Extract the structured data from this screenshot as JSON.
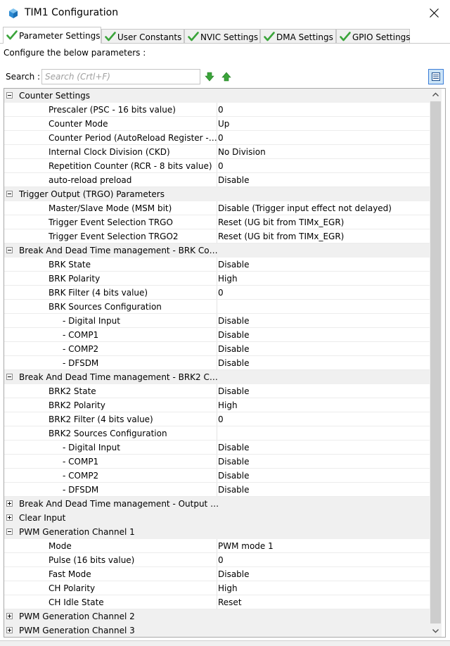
{
  "window": {
    "title": "TIM1 Configuration",
    "app_icon": "cube-icon",
    "close_icon": "close-icon"
  },
  "tabs": [
    {
      "label": "Parameter Settings",
      "icon": "checkmark-icon",
      "active": true
    },
    {
      "label": "User Constants",
      "icon": "checkmark-icon",
      "active": false
    },
    {
      "label": "NVIC Settings",
      "icon": "checkmark-icon",
      "active": false
    },
    {
      "label": "DMA Settings",
      "icon": "checkmark-icon",
      "active": false
    },
    {
      "label": "GPIO Settings",
      "icon": "checkmark-icon",
      "active": false
    }
  ],
  "configure_label": "Configure the below parameters :",
  "search": {
    "label": "Search :",
    "placeholder": "Search (Crtl+F)",
    "value": ""
  },
  "colors": {
    "checkmark": "#3aa43a",
    "arrow": "#3aa43a",
    "group_bg": "#f0f0f0",
    "view_button_bg": "#cce4f7",
    "view_button_border": "#3b7dd8"
  },
  "tree": [
    {
      "type": "group",
      "label": "Counter Settings",
      "expanded": true
    },
    {
      "type": "param",
      "level": 1,
      "name": "Prescaler (PSC - 16 bits value)",
      "value": "0"
    },
    {
      "type": "param",
      "level": 1,
      "name": "Counter Mode",
      "value": "Up"
    },
    {
      "type": "param",
      "level": 1,
      "name": "Counter Period (AutoReload Register - ...",
      "value": "0"
    },
    {
      "type": "param",
      "level": 1,
      "name": "Internal Clock Division (CKD)",
      "value": "No Division"
    },
    {
      "type": "param",
      "level": 1,
      "name": "Repetition Counter (RCR - 8 bits value)",
      "value": "0"
    },
    {
      "type": "param",
      "level": 1,
      "name": "auto-reload preload",
      "value": "Disable"
    },
    {
      "type": "group",
      "label": "Trigger Output (TRGO) Parameters",
      "expanded": true
    },
    {
      "type": "param",
      "level": 1,
      "name": "Master/Slave Mode (MSM bit)",
      "value": "Disable (Trigger input effect not delayed)"
    },
    {
      "type": "param",
      "level": 1,
      "name": "Trigger Event Selection TRGO",
      "value": "Reset (UG bit from TIMx_EGR)"
    },
    {
      "type": "param",
      "level": 1,
      "name": "Trigger Event Selection TRGO2",
      "value": "Reset (UG bit from TIMx_EGR)"
    },
    {
      "type": "group",
      "label": "Break And Dead Time management - BRK Conf...",
      "expanded": true
    },
    {
      "type": "param",
      "level": 1,
      "name": "BRK State",
      "value": "Disable"
    },
    {
      "type": "param",
      "level": 1,
      "name": "BRK Polarity",
      "value": "High"
    },
    {
      "type": "param",
      "level": 1,
      "name": "BRK Filter (4 bits value)",
      "value": "0"
    },
    {
      "type": "param",
      "level": 1,
      "name": "BRK Sources Configuration",
      "value": ""
    },
    {
      "type": "param",
      "level": 2,
      "name": "- Digital Input",
      "value": "Disable"
    },
    {
      "type": "param",
      "level": 2,
      "name": "- COMP1",
      "value": "Disable"
    },
    {
      "type": "param",
      "level": 2,
      "name": "- COMP2",
      "value": "Disable"
    },
    {
      "type": "param",
      "level": 2,
      "name": "- DFSDM",
      "value": "Disable"
    },
    {
      "type": "group",
      "label": "Break And Dead Time management - BRK2 Co...",
      "expanded": true
    },
    {
      "type": "param",
      "level": 1,
      "name": "BRK2 State",
      "value": "Disable"
    },
    {
      "type": "param",
      "level": 1,
      "name": "BRK2 Polarity",
      "value": "High"
    },
    {
      "type": "param",
      "level": 1,
      "name": "BRK2 Filter (4 bits value)",
      "value": "0"
    },
    {
      "type": "param",
      "level": 1,
      "name": "BRK2 Sources Configuration",
      "value": ""
    },
    {
      "type": "param",
      "level": 2,
      "name": "- Digital Input",
      "value": "Disable"
    },
    {
      "type": "param",
      "level": 2,
      "name": "- COMP1",
      "value": "Disable"
    },
    {
      "type": "param",
      "level": 2,
      "name": "- COMP2",
      "value": "Disable"
    },
    {
      "type": "param",
      "level": 2,
      "name": "- DFSDM",
      "value": "Disable"
    },
    {
      "type": "group",
      "label": "Break And Dead Time management - Output C...",
      "expanded": false
    },
    {
      "type": "group",
      "label": "Clear Input",
      "expanded": false
    },
    {
      "type": "group",
      "label": "PWM Generation Channel 1",
      "expanded": true
    },
    {
      "type": "param",
      "level": 1,
      "name": "Mode",
      "value": "PWM mode 1"
    },
    {
      "type": "param",
      "level": 1,
      "name": "Pulse (16 bits value)",
      "value": "0"
    },
    {
      "type": "param",
      "level": 1,
      "name": "Fast Mode",
      "value": "Disable"
    },
    {
      "type": "param",
      "level": 1,
      "name": "CH Polarity",
      "value": "High"
    },
    {
      "type": "param",
      "level": 1,
      "name": "CH Idle State",
      "value": "Reset"
    },
    {
      "type": "group",
      "label": "PWM Generation Channel 2",
      "expanded": false
    },
    {
      "type": "group",
      "label": "PWM Generation Channel 3",
      "expanded": false
    }
  ]
}
